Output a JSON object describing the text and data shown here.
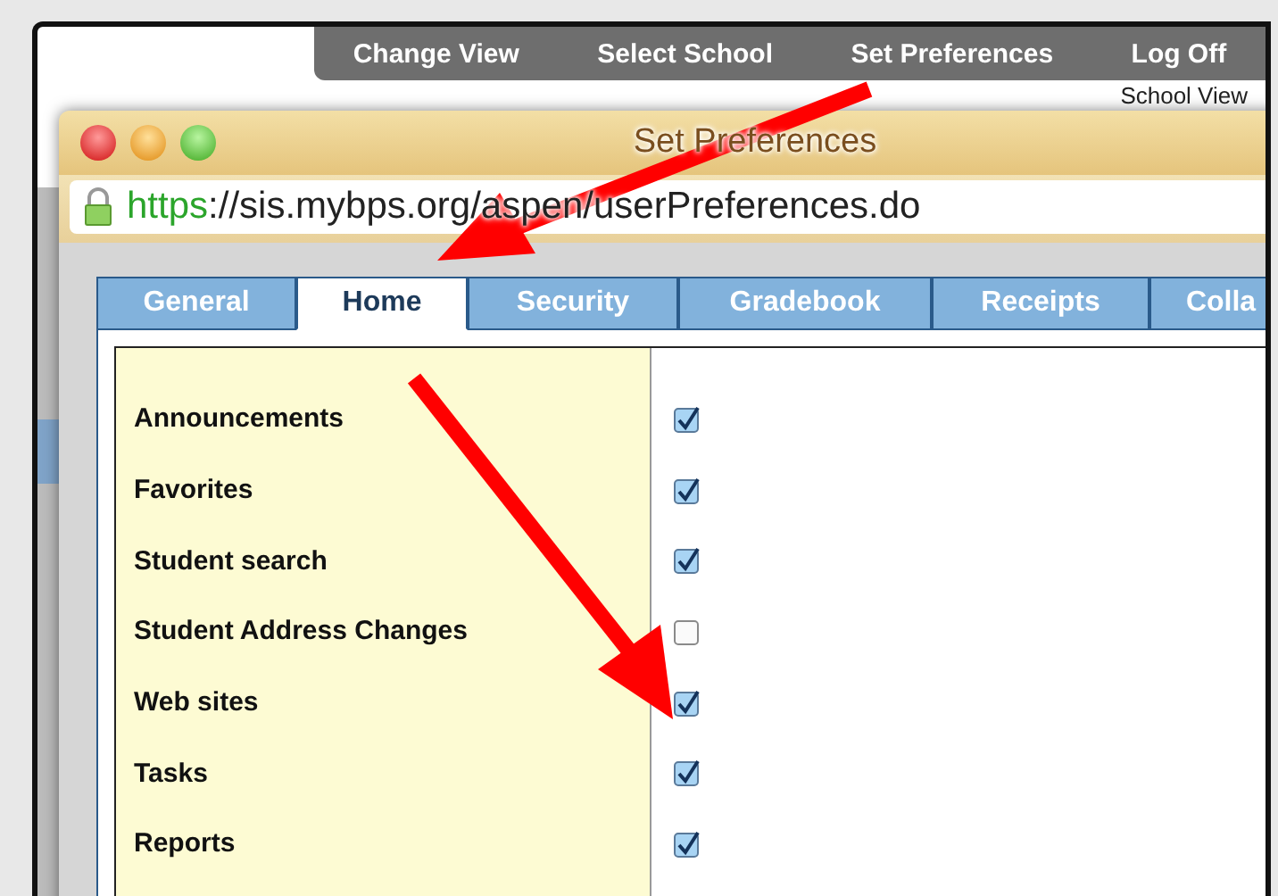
{
  "top_menu": [
    "Change View",
    "Select School",
    "Set Preferences",
    "Log Off"
  ],
  "page_heading": "School View",
  "dialog": {
    "title": "Set Preferences",
    "url_scheme": "https",
    "url_rest": "://sis.mybps.org/aspen/userPreferences.do"
  },
  "tabs": [
    {
      "label": "General",
      "selected": false
    },
    {
      "label": "Home",
      "selected": true
    },
    {
      "label": "Security",
      "selected": false
    },
    {
      "label": "Gradebook",
      "selected": false
    },
    {
      "label": "Receipts",
      "selected": false
    },
    {
      "label": "Colla",
      "selected": false
    }
  ],
  "options": [
    {
      "label": "Announcements",
      "checked": true
    },
    {
      "label": "Favorites",
      "checked": true
    },
    {
      "label": "Student search",
      "checked": true
    },
    {
      "label": "Student Address Changes",
      "checked": false
    },
    {
      "label": "Web sites",
      "checked": true
    },
    {
      "label": "Tasks",
      "checked": true
    },
    {
      "label": "Reports",
      "checked": true
    }
  ]
}
